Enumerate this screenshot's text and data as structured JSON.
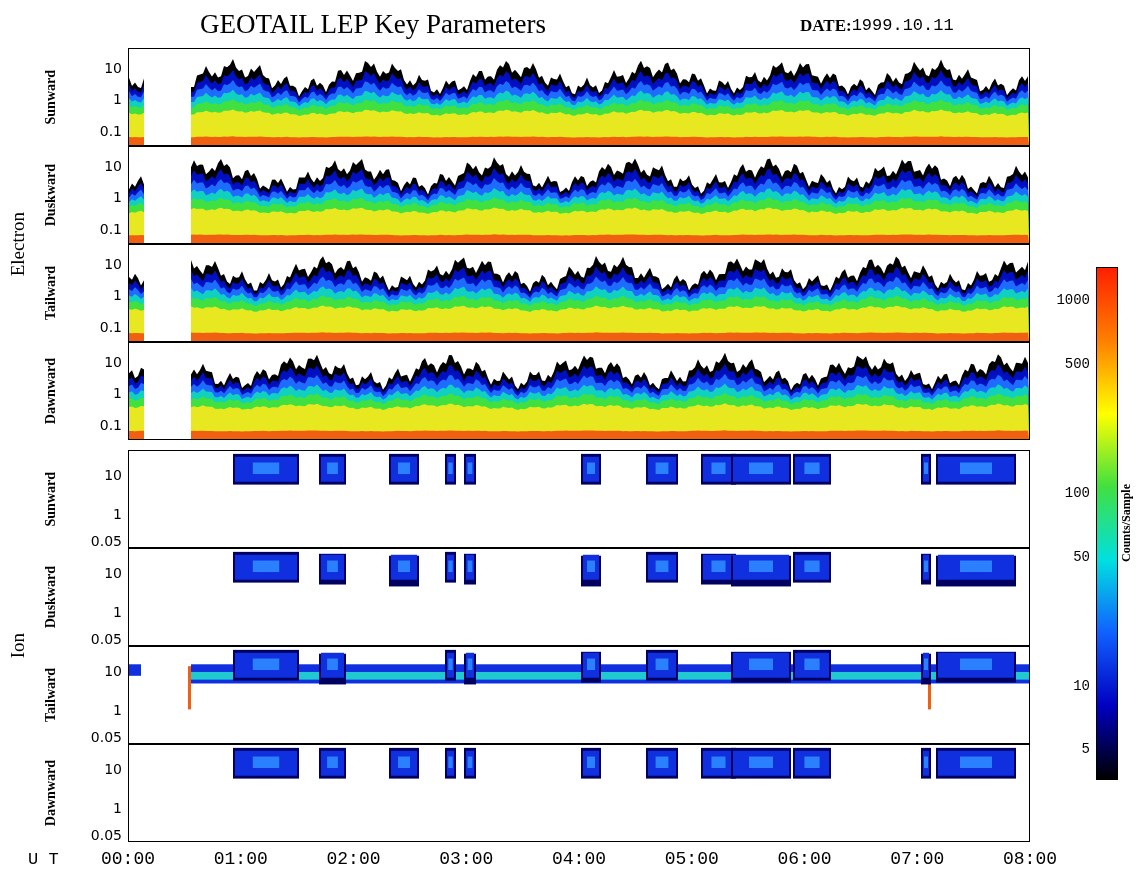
{
  "title": "GEOTAIL LEP Key Parameters",
  "date_label": "DATE:",
  "date": "1999.10.11",
  "groups": [
    {
      "name": "Electron",
      "kind": "electron",
      "panels": [
        {
          "direction": "Sunward",
          "yticks": [
            "10",
            "1",
            "0.1"
          ]
        },
        {
          "direction": "Duskward",
          "yticks": [
            "10",
            "1",
            "0.1"
          ]
        },
        {
          "direction": "Tailward",
          "yticks": [
            "10",
            "1",
            "0.1"
          ]
        },
        {
          "direction": "Dawnward",
          "yticks": [
            "10",
            "1",
            "0.1"
          ]
        }
      ]
    },
    {
      "name": "Ion",
      "kind": "ion",
      "panels": [
        {
          "direction": "Sunward",
          "yticks": [
            "10",
            "1",
            "0.05"
          ]
        },
        {
          "direction": "Duskward",
          "yticks": [
            "10",
            "1",
            "0.05"
          ]
        },
        {
          "direction": "Tailward",
          "yticks": [
            "10",
            "1",
            "0.05"
          ]
        },
        {
          "direction": "Dawnward",
          "yticks": [
            "10",
            "1",
            "0.05"
          ]
        }
      ]
    }
  ],
  "time_axis": {
    "label": "U T",
    "ticks": [
      "00:00",
      "01:00",
      "02:00",
      "03:00",
      "04:00",
      "05:00",
      "06:00",
      "07:00",
      "08:00"
    ]
  },
  "colorbar": {
    "title": "Counts/Sample",
    "ticks": [
      "1000",
      "500",
      "100",
      "50",
      "10",
      "5"
    ]
  }
}
